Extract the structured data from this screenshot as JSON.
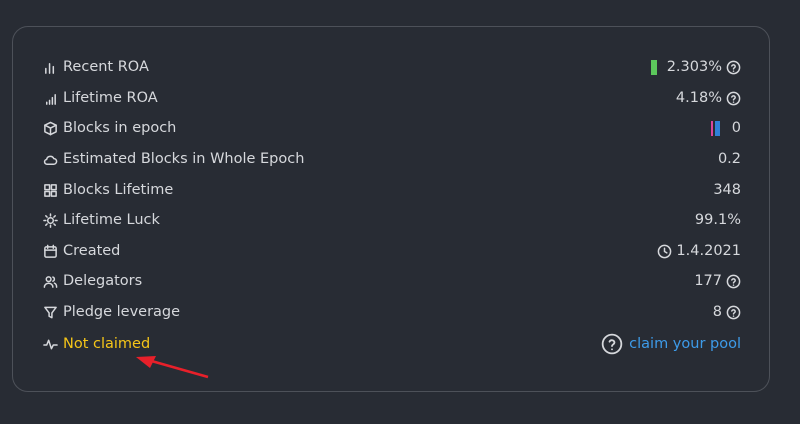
{
  "rows": [
    {
      "label": "Recent ROA",
      "value": "2.303%",
      "icon": "bar-chart-icon"
    },
    {
      "label": "Lifetime ROA",
      "value": "4.18%",
      "icon": "signal-icon"
    },
    {
      "label": "Blocks in epoch",
      "value": "0",
      "icon": "cube-icon"
    },
    {
      "label": "Estimated Blocks in Whole Epoch",
      "value": "0.2",
      "icon": "cloud-icon"
    },
    {
      "label": "Blocks Lifetime",
      "value": "348",
      "icon": "grid-icon"
    },
    {
      "label": "Lifetime Luck",
      "value": "99.1%",
      "icon": "sun-icon"
    },
    {
      "label": "Created",
      "value": "1.4.2021",
      "icon": "calendar-icon"
    },
    {
      "label": "Delegators",
      "value": "177",
      "icon": "users-icon"
    },
    {
      "label": "Pledge leverage",
      "value": "8",
      "icon": "filter-icon"
    }
  ],
  "claim": {
    "status": "Not claimed",
    "link": "claim your pool"
  },
  "colors": {
    "accent_yellow": "#f5c518",
    "link_blue": "#3d9be9",
    "roa_bar": "#5cc85c",
    "arrow": "#e8202a"
  }
}
